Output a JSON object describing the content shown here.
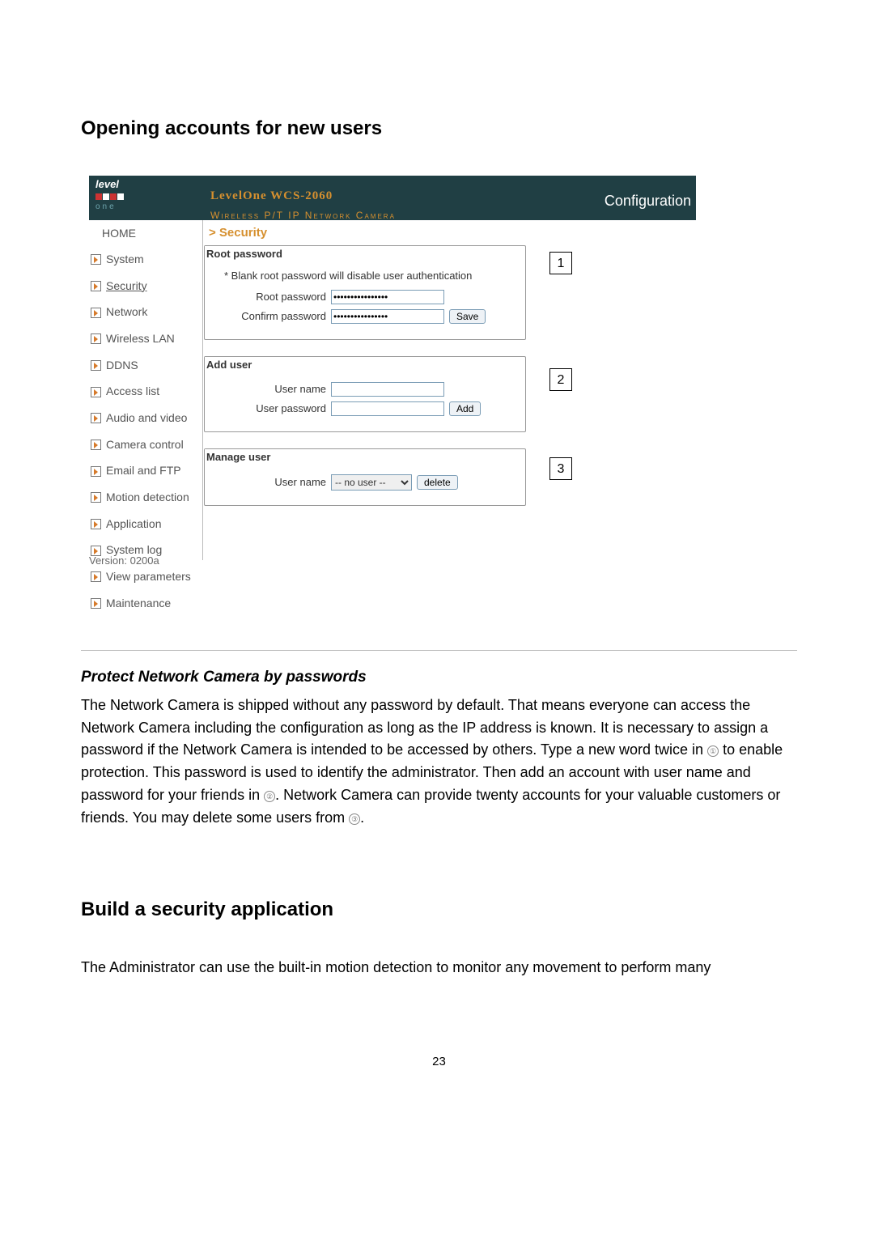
{
  "headings": {
    "h1": "Opening accounts for new users",
    "h2": "Build a security application"
  },
  "screenshot": {
    "header": {
      "logo_top": "level",
      "logo_one": "one",
      "model": "LevelOne WCS-2060",
      "subtitle": "Wireless P/T IP Network Camera",
      "conf": "Configuration"
    },
    "nav": {
      "home": "HOME",
      "items": [
        "System",
        "Security",
        "Network",
        "Wireless LAN",
        "DDNS",
        "Access list",
        "Audio and video",
        "Camera control",
        "Email and FTP",
        "Motion detection",
        "Application",
        "System log",
        "View parameters",
        "Maintenance"
      ],
      "active_index": 1,
      "version": "Version: 0200a"
    },
    "crumb": "> Security",
    "panel1": {
      "legend": "Root password",
      "note": "* Blank root password will disable user authentication",
      "root_label": "Root password",
      "confirm_label": "Confirm password",
      "save": "Save",
      "mask": "••••••••••••••••"
    },
    "panel2": {
      "legend": "Add user",
      "name_label": "User name",
      "pw_label": "User password",
      "add": "Add"
    },
    "panel3": {
      "legend": "Manage user",
      "name_label": "User name",
      "select": "-- no user --",
      "del": "delete"
    },
    "callouts": {
      "c1": "1",
      "c2": "2",
      "c3": "3"
    }
  },
  "protect": {
    "title": "Protect Network Camera by passwords",
    "p1a": "The Network Camera is shipped without any password by default. That means everyone can access the Network Camera including the configuration as long as the IP address is known. It is necessary to assign a password if the Network Camera is intended to be accessed by others. Type a new word twice in ",
    "p1b": " to enable protection. This password is used to identify the administrator. Then add an account with user name and password for your friends in ",
    "p1c": ". Network Camera can provide twenty accounts for your valuable customers or friends. You may delete some users from ",
    "p1d": ".",
    "r1": "①",
    "r2": "②",
    "r3": "③"
  },
  "build_p": "The Administrator can use the built-in motion detection to monitor any movement to perform many",
  "page_no": "23"
}
